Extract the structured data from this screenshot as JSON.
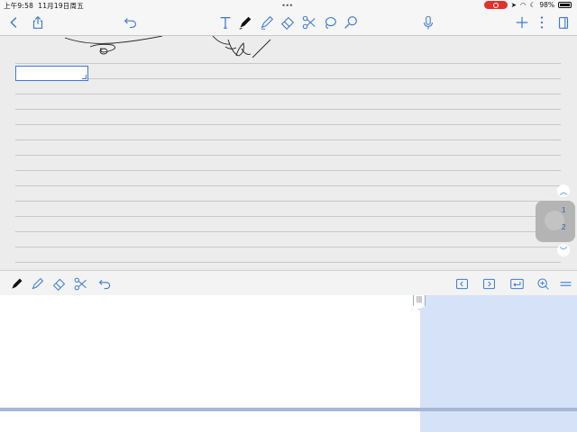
{
  "status_bar": {
    "time": "上午9:58",
    "date": "11月19日周五",
    "battery": "98%",
    "battery_level": 0.98
  },
  "toolbar": {
    "icons": [
      "back-icon",
      "share-icon",
      "undo-icon",
      "text-tool-icon",
      "pen-icon",
      "highlighter-icon",
      "eraser-icon",
      "scissors-icon",
      "lasso-icon",
      "zoom-icon",
      "microphone-icon",
      "add-icon",
      "more-icon",
      "pages-icon"
    ]
  },
  "page": {
    "current_page": "1",
    "total_pages": "2"
  },
  "edit_toolbar": {
    "icons": [
      "pen-icon",
      "highlighter-icon",
      "eraser-icon",
      "scissors-icon",
      "undo-icon",
      "prev-icon",
      "next-icon",
      "return-icon",
      "zoom-in-icon",
      "menu-icon"
    ]
  },
  "colors": {
    "accent": "#3b7ad6",
    "zoom_window": "#d6e2f8",
    "recording": "#e0312d"
  }
}
